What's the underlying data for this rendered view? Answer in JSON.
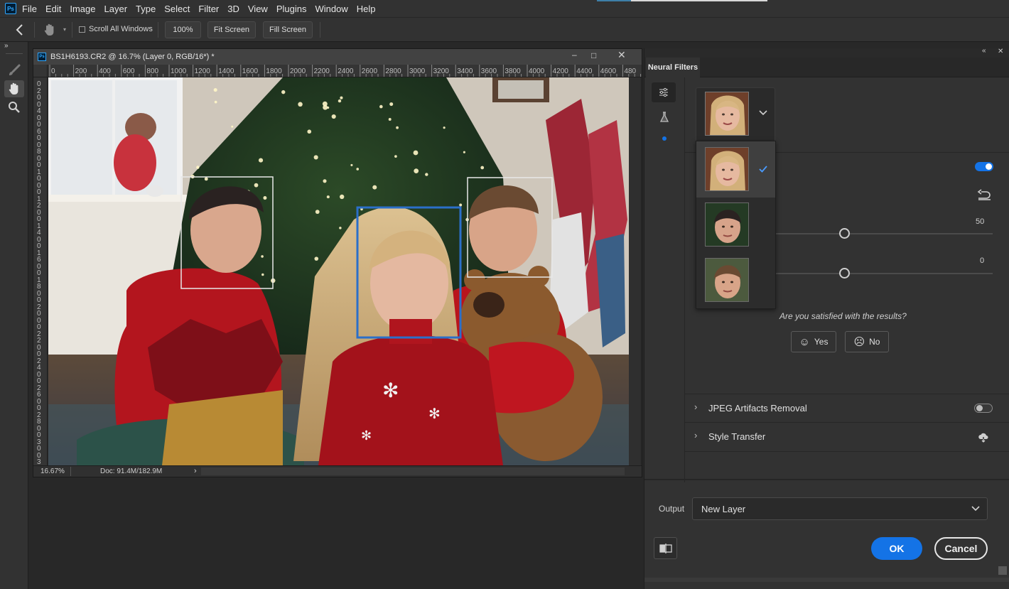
{
  "app": {
    "logo": "Ps"
  },
  "menu": [
    "File",
    "Edit",
    "Image",
    "Layer",
    "Type",
    "Select",
    "Filter",
    "3D",
    "View",
    "Plugins",
    "Window",
    "Help"
  ],
  "options": {
    "scroll_all": "Scroll All Windows",
    "zoom100": "100%",
    "fit_screen": "Fit Screen",
    "fill_screen": "Fill Screen"
  },
  "document": {
    "title": "BS1H6193.CR2 @ 16.7% (Layer 0, RGB/16*) *",
    "ruler_h": [
      "0",
      "200",
      "400",
      "600",
      "800",
      "1000",
      "1200",
      "1400",
      "1600",
      "1800",
      "2000",
      "2200",
      "2400",
      "2600",
      "2800",
      "3000",
      "3200",
      "3400",
      "3600",
      "3800",
      "4000",
      "4200",
      "4400",
      "4600",
      "480"
    ],
    "ruler_v": [
      "0",
      "2",
      "0",
      "0",
      "4",
      "0",
      "0",
      "6",
      "0",
      "0",
      "8",
      "0",
      "0",
      "1",
      "0",
      "0",
      "0",
      "1",
      "2",
      "0",
      "0",
      "1",
      "4",
      "0",
      "0",
      "1",
      "6",
      "0",
      "0",
      "1",
      "8",
      "0",
      "0",
      "2",
      "0",
      "0",
      "0",
      "2",
      "2",
      "0",
      "0",
      "2",
      "4",
      "0",
      "0",
      "2",
      "6",
      "0",
      "0",
      "2",
      "8",
      "0",
      "0",
      "3",
      "0",
      "0",
      "3"
    ],
    "zoom": "16.67%",
    "doc_size": "Doc: 91.4M/182.9M"
  },
  "panel": {
    "tab": "Neural Filters",
    "slider1_value": "50",
    "slider2_value": "0",
    "satisfied": "Are you satisfied with the results?",
    "yes": "Yes",
    "no": "No",
    "filters": [
      {
        "name": "JPEG Artifacts Removal"
      },
      {
        "name": "Style Transfer"
      }
    ],
    "output_label": "Output",
    "output_value": "New Layer",
    "ok": "OK",
    "cancel": "Cancel"
  },
  "colors": {
    "accent": "#1473e6",
    "face_box_selected": "#2b6fc9",
    "face_box": "#e8e8e8"
  }
}
